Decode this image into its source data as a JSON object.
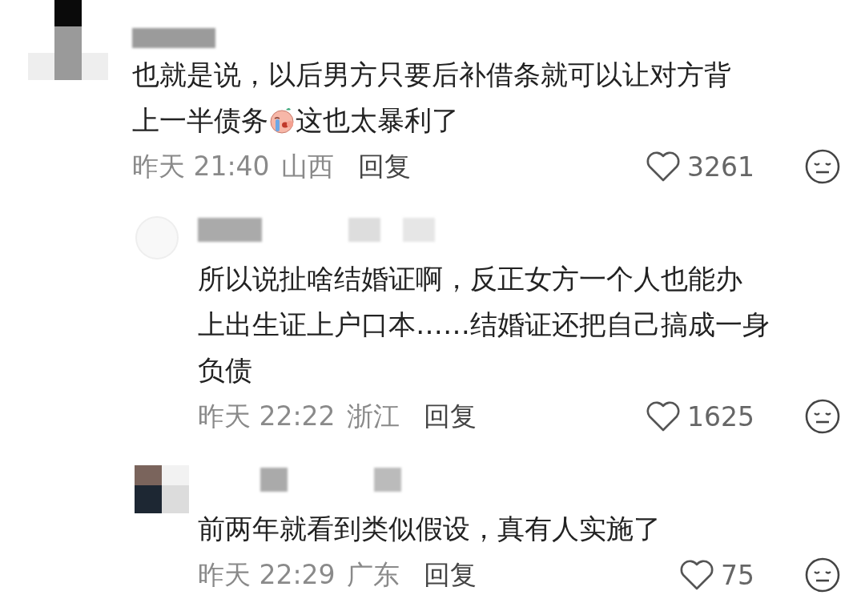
{
  "comments": [
    {
      "kind": "comment",
      "lines": [
        [
          {
            "kind": "text",
            "text": "也就是说，以后男方只要后补借条就可以让对方背"
          }
        ],
        [
          {
            "kind": "text",
            "text": "上一半债务"
          },
          {
            "kind": "emoji"
          },
          {
            "kind": "text",
            "text": "这也太暴利了"
          }
        ]
      ],
      "time": "昨天 21:40",
      "region": "山西",
      "reply": "回复",
      "likes": "3261"
    },
    {
      "kind": "reply",
      "lines": [
        [
          {
            "kind": "text",
            "text": "所以说扯啥结婚证啊，反正女方一个人也能办"
          }
        ],
        [
          {
            "kind": "text",
            "text": "上出生证上户口本……结婚证还把自己搞成一身"
          }
        ],
        [
          {
            "kind": "text",
            "text": "负债"
          }
        ]
      ],
      "time": "昨天 22:22",
      "region": "浙江",
      "reply": "回复",
      "likes": "1625"
    },
    {
      "kind": "reply",
      "lines": [
        [
          {
            "kind": "text",
            "text": "前两年就看到类似假设，真有人实施了"
          }
        ]
      ],
      "time": "昨天 22:29",
      "region": "广东",
      "reply": "回复",
      "likes": "75"
    }
  ]
}
